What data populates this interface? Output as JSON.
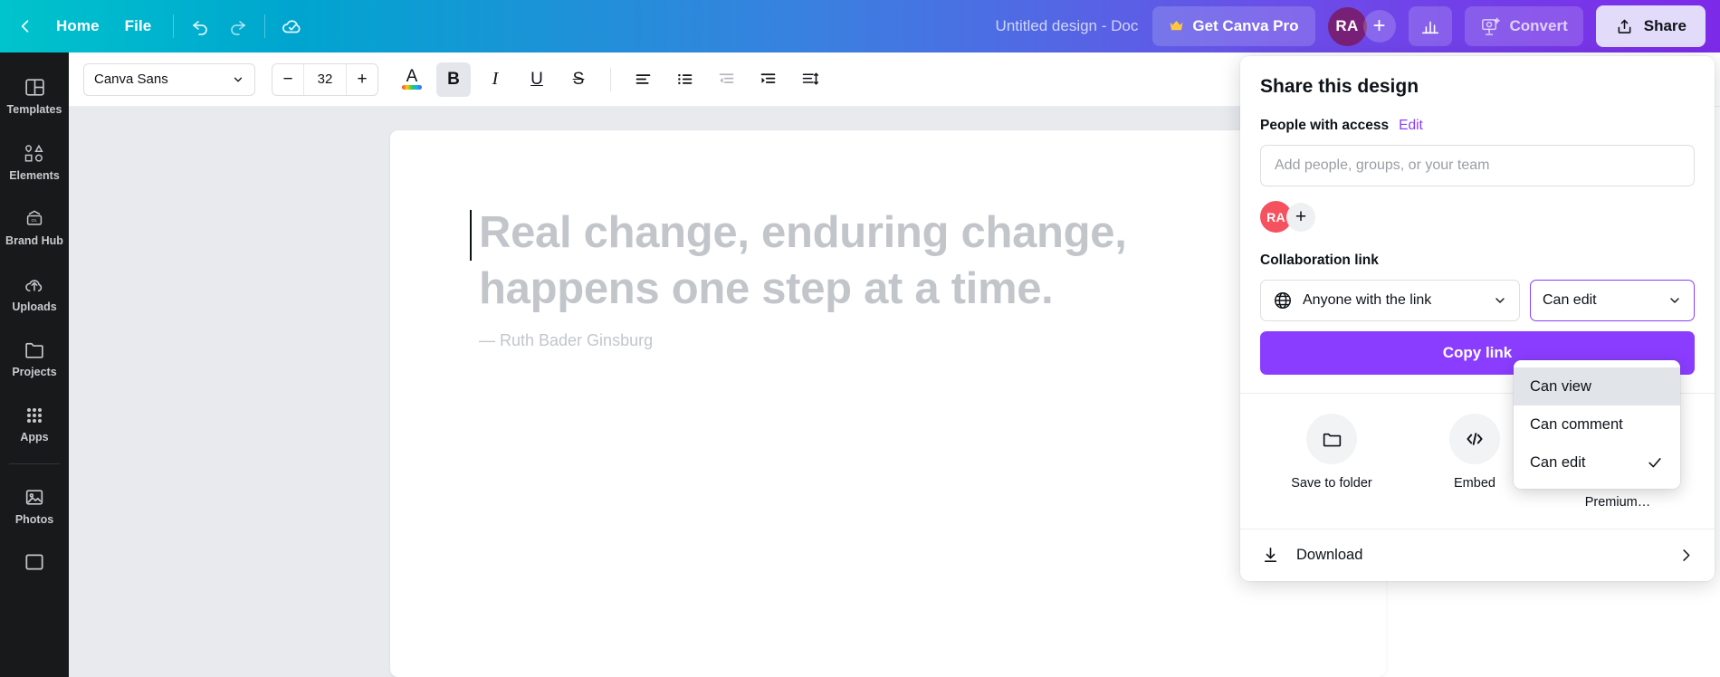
{
  "topbar": {
    "back_icon": "chevron-left-icon",
    "home_label": "Home",
    "file_label": "File",
    "undo_icon": "undo-icon",
    "redo_icon": "redo-icon",
    "cloud_saved_icon": "cloud-check-icon",
    "doc_title": "Untitled design - Doc",
    "pro_label": "Get Canva Pro",
    "crown_icon": "crown-icon",
    "avatar_initials": "RA",
    "avatar_plus": "+",
    "insights_icon": "bar-chart-icon",
    "convert_icon": "convert-icon",
    "convert_label": "Convert",
    "share_icon": "share-upload-icon",
    "share_label": "Share"
  },
  "rail": {
    "items": [
      {
        "label": "Templates",
        "icon": "templates-icon"
      },
      {
        "label": "Elements",
        "icon": "elements-icon"
      },
      {
        "label": "Brand Hub",
        "icon": "brand-hub-icon"
      },
      {
        "label": "Uploads",
        "icon": "uploads-icon"
      },
      {
        "label": "Projects",
        "icon": "projects-icon"
      },
      {
        "label": "Apps",
        "icon": "apps-icon"
      }
    ],
    "items_below": [
      {
        "label": "Photos",
        "icon": "photos-icon"
      }
    ]
  },
  "toolbar": {
    "font_family": "Canva Sans",
    "font_dropdown_icon": "chevron-down-icon",
    "decrease_label": "−",
    "font_size": "32",
    "increase_label": "+",
    "text_color_icon": "text-color-icon",
    "bold_label": "B",
    "italic_label": "I",
    "underline_label": "U",
    "strikethrough_label": "S",
    "align_icon": "align-left-icon",
    "list_icon": "bullet-list-icon",
    "outdent_icon": "outdent-icon",
    "indent_icon": "indent-icon",
    "line_spacing_icon": "line-spacing-icon"
  },
  "canvas": {
    "quote_line1": "Real change, enduring change,",
    "quote_line2": "happens one step at a time.",
    "attribution": "— Ruth Bader Ginsburg"
  },
  "share": {
    "title": "Share this design",
    "people_label": "People with access",
    "edit_link": "Edit",
    "people_placeholder": "Add people, groups, or your team",
    "people_value": "",
    "member_initials": "RA",
    "add_member_label": "+",
    "collab_label": "Collaboration link",
    "globe_icon": "globe-icon",
    "audience_value": "Anyone with the link",
    "audience_caret": "chevron-down-icon",
    "permission_value": "Can edit",
    "permission_caret": "chevron-down-icon",
    "copy_link_label": "Copy link",
    "actions": [
      {
        "label": "Save to folder",
        "icon": "folder-icon"
      },
      {
        "label": "Embed",
        "icon": "code-icon"
      },
      {
        "label": "Purchase Premium…",
        "icon": "premium-image-icon"
      }
    ],
    "download_label": "Download",
    "download_icon": "download-icon",
    "download_chevron": "chevron-right-icon",
    "permission_menu": {
      "items": [
        {
          "label": "Can view",
          "checked": false,
          "hovered": true
        },
        {
          "label": "Can comment",
          "checked": false,
          "hovered": false
        },
        {
          "label": "Can edit",
          "checked": true,
          "hovered": false
        }
      ],
      "check_glyph": "✓"
    }
  },
  "colors": {
    "brand_purple": "#8b3dff",
    "topbar_start": "#00c4cc",
    "topbar_end": "#7d2ae8",
    "avatar_top": "#782077",
    "avatar_panel": "#f5515f",
    "canvas_bg": "#e9eaee"
  }
}
